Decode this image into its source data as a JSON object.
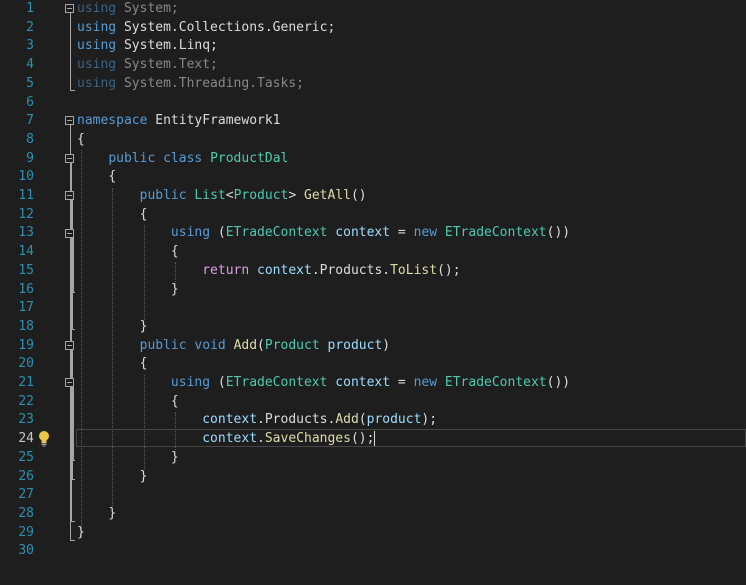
{
  "line_numbers": [
    "1",
    "2",
    "3",
    "4",
    "5",
    "6",
    "7",
    "8",
    "9",
    "10",
    "11",
    "12",
    "13",
    "14",
    "15",
    "16",
    "17",
    "18",
    "19",
    "20",
    "21",
    "22",
    "23",
    "24",
    "25",
    "26",
    "27",
    "28",
    "29",
    "30"
  ],
  "code": {
    "l1_kw": "using",
    "l1_ns": " System;",
    "l2_kw": "using",
    "l2_ns": " System.Collections.Generic;",
    "l3_kw": "using",
    "l3_ns": " System.Linq;",
    "l4_kw": "using",
    "l4_ns": " System.Text;",
    "l5_kw": "using",
    "l5_ns": " System.Threading.Tasks;",
    "l7_kw": "namespace",
    "l7_name": " EntityFramework1",
    "l8": "{",
    "l9_kw1": "public",
    "l9_kw2": "class",
    "l9_type": "ProductDal",
    "l10": "{",
    "l11_kw": "public",
    "l11_type": "List",
    "l11_lt": "<",
    "l11_arg": "Product",
    "l11_gt": ">",
    "l11_method": "GetAll",
    "l11_parens": "()",
    "l12": "{",
    "l13_kw": "using",
    "l13_open": " (",
    "l13_type": "ETradeContext",
    "l13_var": "context",
    "l13_eq": " = ",
    "l13_new": "new",
    "l13_type2": "ETradeContext",
    "l13_close": "())",
    "l14": "{",
    "l15_kw": "return",
    "l15_var": "context",
    "l15_dot1": ".Products.",
    "l15_method": "ToList",
    "l15_end": "();",
    "l16": "}",
    "l18": "}",
    "l19_kw1": "public",
    "l19_kw2": "void",
    "l19_method": "Add",
    "l19_open": "(",
    "l19_type": "Product",
    "l19_param": "product",
    "l19_close": ")",
    "l20": "{",
    "l21_kw": "using",
    "l21_open": " (",
    "l21_type": "ETradeContext",
    "l21_var": "context",
    "l21_eq": " = ",
    "l21_new": "new",
    "l21_type2": "ETradeContext",
    "l21_close": "())",
    "l22": "{",
    "l23_var": "context",
    "l23_dot": ".Products.",
    "l23_method": "Add",
    "l23_open": "(",
    "l23_param": "product",
    "l23_end": ");",
    "l24_var": "context",
    "l24_dot": ".",
    "l24_method": "SaveChanges",
    "l24_end": "();",
    "l25": "}",
    "l26": "}",
    "l28": "}",
    "l29": "}"
  },
  "colors": {
    "background": "#1e1e1e",
    "line_number": "#2b91af",
    "keyword": "#569cd6",
    "type": "#4ec9b0",
    "method": "#dcdcaa",
    "variable": "#9cdcfe",
    "text": "#dcdcdc",
    "control_keyword": "#d8a0df"
  },
  "icons": {
    "quick_action": "lightbulb-icon",
    "fold": "collapse-box-icon"
  }
}
